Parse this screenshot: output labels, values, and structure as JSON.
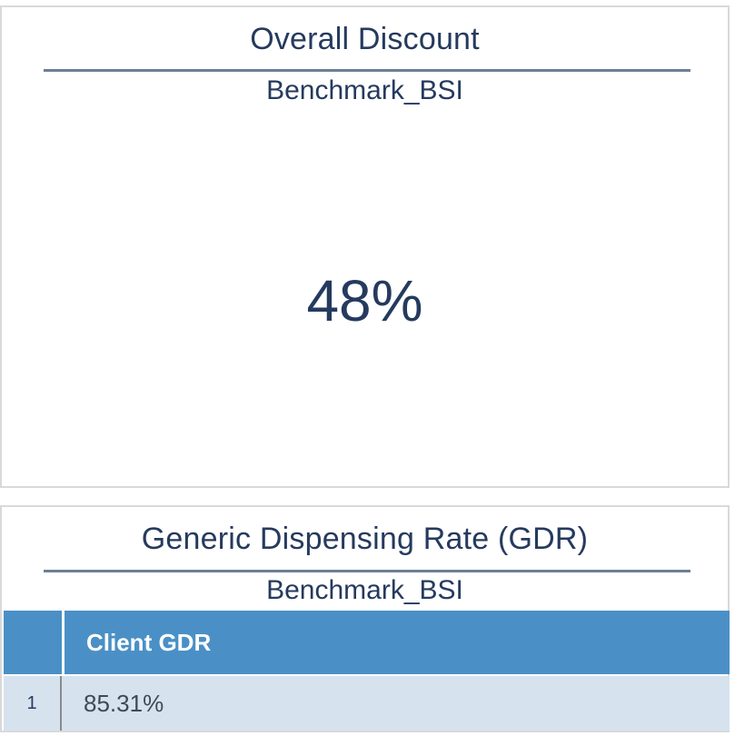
{
  "overall_discount": {
    "title": "Overall Discount",
    "subtitle": "Benchmark_BSI",
    "value": "48%"
  },
  "gdr": {
    "title": "Generic Dispensing Rate (GDR)",
    "subtitle": "Benchmark_BSI",
    "columns": [
      "",
      "Client GDR"
    ],
    "rows": [
      {
        "index": "1",
        "client_gdr": "85.31%"
      }
    ]
  },
  "colors": {
    "header_blue": "#4a90c6",
    "row_bg": "#d6e3ef",
    "title_navy": "#253a5e"
  }
}
